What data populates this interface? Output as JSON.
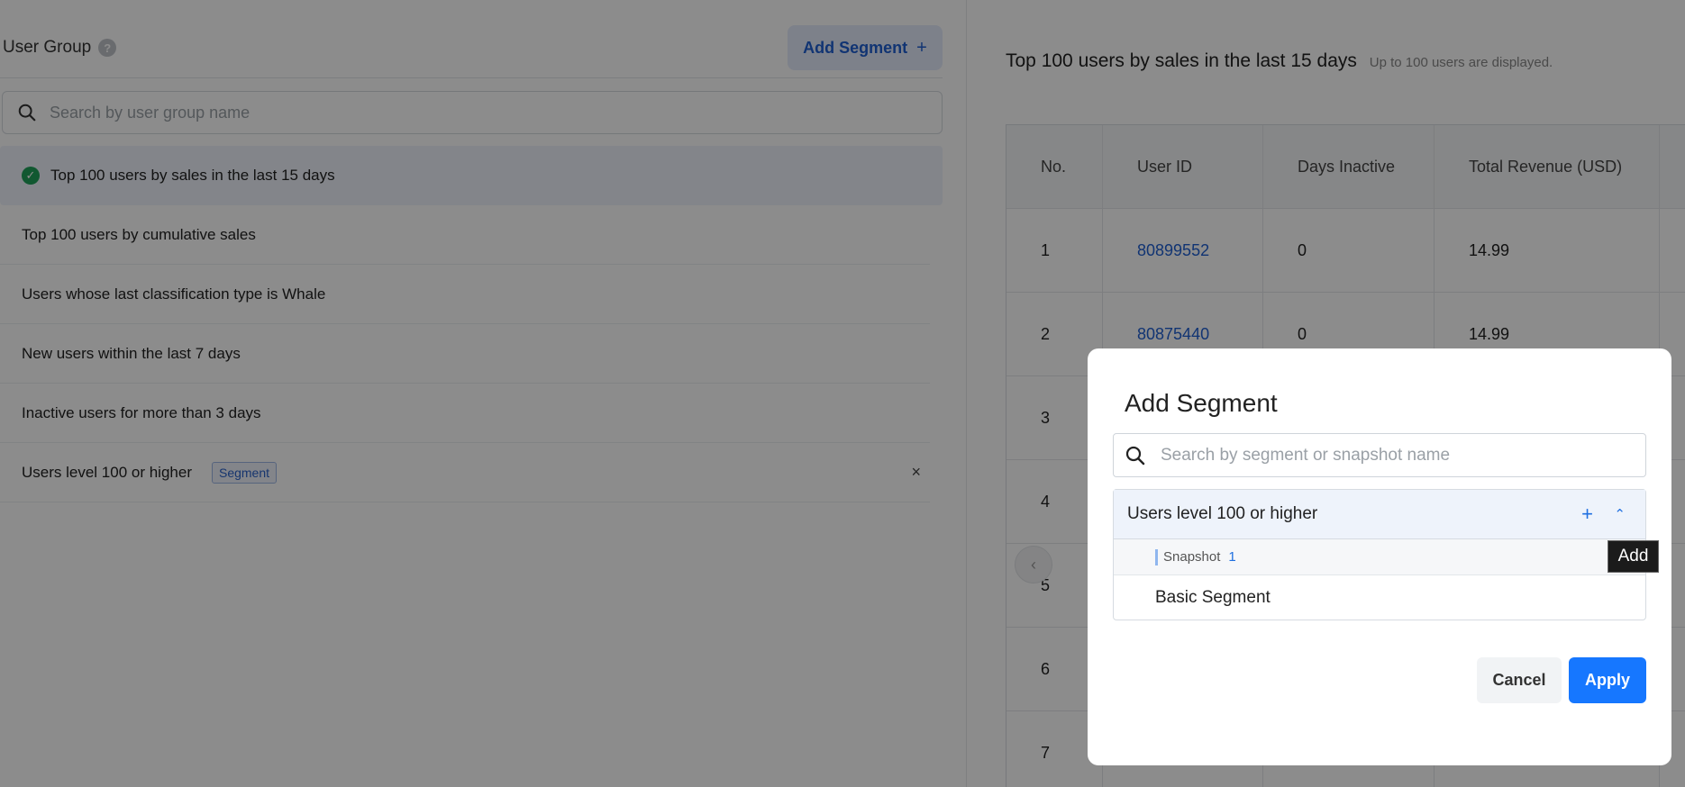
{
  "user_group": {
    "title": "User Group",
    "help": "?",
    "add_button_label": "Add Segment",
    "add_button_plus": "+",
    "search_placeholder": "Search by user group name",
    "items": [
      {
        "label": "Top 100 users by sales in the last 15 days",
        "active": true
      },
      {
        "label": "Top 100 users by cumulative sales"
      },
      {
        "label": "Users whose last classification type is Whale"
      },
      {
        "label": "New users within the last 7 days"
      },
      {
        "label": "Inactive users for more than 3 days"
      },
      {
        "label": "Users level 100 or higher",
        "tag": "Segment",
        "close": "×"
      }
    ]
  },
  "detail": {
    "title": "Top 100 users by sales in the last 15 days",
    "subtitle": "Up to 100 users are displayed.",
    "columns": [
      "No.",
      "User ID",
      "Days Inactive",
      "Total Revenue (USD)"
    ],
    "rows": [
      {
        "no": "1",
        "user_id": "80899552",
        "days": "0",
        "revenue": "14.99"
      },
      {
        "no": "2",
        "user_id": "80875440",
        "days": "0",
        "revenue": "14.99"
      },
      {
        "no": "3"
      },
      {
        "no": "4"
      },
      {
        "no": "5"
      },
      {
        "no": "6"
      },
      {
        "no": "7"
      }
    ],
    "pager_prev": "‹"
  },
  "modal": {
    "title": "Add Segment",
    "search_placeholder": "Search by segment or snapshot name",
    "segment_name": "Users level 100 or higher",
    "segment_plus": "+",
    "segment_chevron": "⌃",
    "snapshot_label": "Snapshot",
    "snapshot_count": "1",
    "basic_label": "Basic Segment",
    "tooltip": "Add",
    "cancel_label": "Cancel",
    "apply_label": "Apply"
  },
  "colors": {
    "accent": "#1677ff",
    "link": "#1f5fd1",
    "success": "#1fa05a",
    "overlay": "rgba(0,0,0,0.45)"
  }
}
